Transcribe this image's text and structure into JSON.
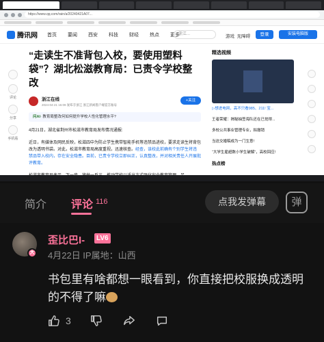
{
  "browser": {
    "url": "https://www.qq.com/rain/a/20240421A07..."
  },
  "site": {
    "logo": "腾讯网",
    "nav": [
      "首页",
      "要闻",
      "西安",
      "科技",
      "财经",
      "热点",
      "更多"
    ],
    "search_placeholder": "浙江...",
    "game": "游戏",
    "barrier_free": "无障碍",
    "login": "登录",
    "install": "安装电脑版"
  },
  "rail": [
    "评论",
    "分享",
    "手机看"
  ],
  "article": {
    "headline": "“走读生不准背包入校，要使用塑料袋”？湖北松滋教育局：已责令学校整改",
    "source_name": "浙江在线",
    "source_meta": "2024-04-21 15:09 发布于浙江 浙江新闻客户端官方账号",
    "follow": "+关注",
    "ai_label": "问AI",
    "ai_text": "· 教育局整改何如何提升学校人性化管理水平?",
    "p1": "4月21日，湖北省荆州市松滋市教育局发布情况通报:",
    "p2_a": "近日，有媒体及网民反映，松滋四中为防止学生携带智能手机等违禁品进校，要求走读生将背包改为透明书袋。对此，松滋市教育局高度重视，迅速核查。",
    "p2_b": "经查，该校此前确有个别学生将违禁品带入校内，存在安全隐患。目前，已责令学校立即纠正，认真整改，并对相关责任人开展批评教育。",
    "p3": "松滋市教育局表示，下一步，将举一反三，推动学校以适当方式强化安全教育管理，另"
  },
  "right": {
    "title": "精选视频",
    "video_caption": "▷想进电网，高不只看985、211! 宝...",
    "items": [
      "王者荣耀：揭秘抽签海队还在已觉得...",
      "多校公共事业管理专业，拟撤销",
      "当这交婚稿成为一门生意!",
      "“大学生雇超数小学生破解”，高校回应!"
    ],
    "hot": "热点榜"
  },
  "tabs": {
    "intro": "简介",
    "comments": "评论",
    "comments_count": "116",
    "danmaku": "点我发弹幕",
    "danmaku_btn": "弹"
  },
  "comment": {
    "username": "歪比巴I-",
    "level": "LV6",
    "avatar_badge": "大",
    "meta": "4月22日  IP属地：山西",
    "text": "书包里有啥都想一眼看到，你直接把校服换成透明的不得了嘛",
    "likes": "3"
  },
  "colors": {
    "accent": "#fb7299",
    "link_blue": "#1a73e8"
  }
}
